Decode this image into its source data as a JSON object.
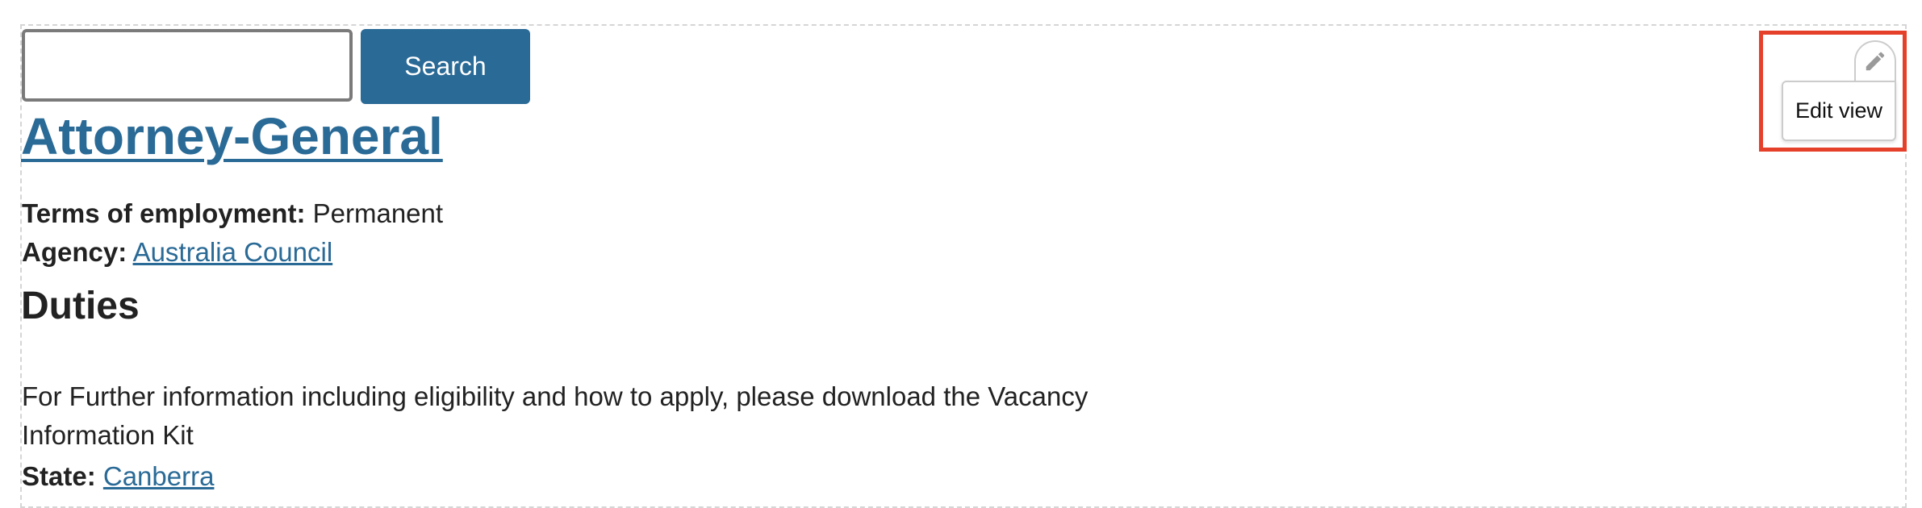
{
  "search": {
    "value": "",
    "placeholder": "",
    "button_label": "Search"
  },
  "job": {
    "title": "Attorney-General",
    "terms_label": "Terms of employment:",
    "terms_value": "Permanent",
    "agency_label": "Agency:",
    "agency_value": "Australia Council",
    "duties_heading": "Duties",
    "duties_text": "For Further information including eligibility and how to apply, please download the Vacancy Information Kit",
    "state_label": "State:",
    "state_value": "Canberra"
  },
  "contextual": {
    "icon": "pencil-icon",
    "edit_view_label": "Edit view",
    "highlight_color": "#e5402a"
  },
  "colors": {
    "link": "#2a6a96",
    "button_bg": "#2a6a96",
    "text": "#222222"
  }
}
